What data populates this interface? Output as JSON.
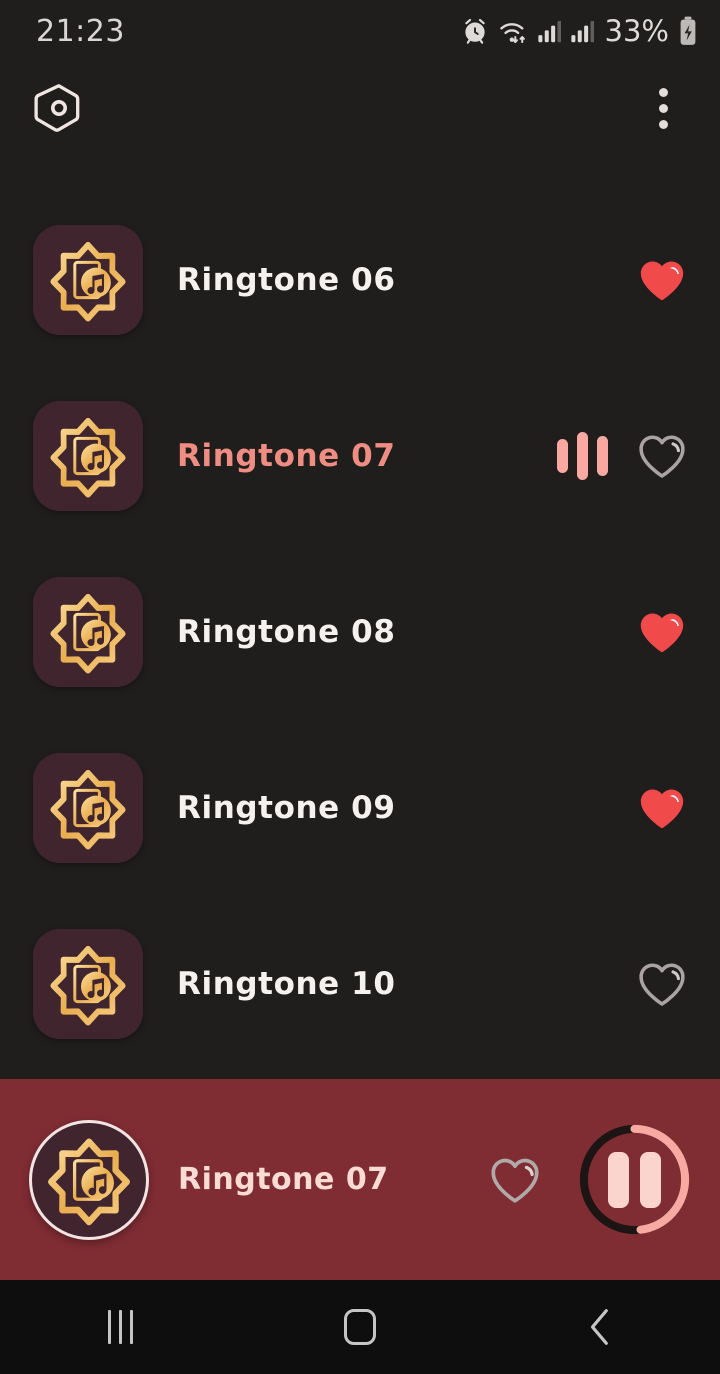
{
  "status_bar": {
    "time": "21:23",
    "battery_percent": "33%",
    "icons": [
      "alarm-icon",
      "wifi-icon",
      "signal-icon-1",
      "signal-icon-2",
      "battery-charging-icon"
    ]
  },
  "app_bar": {
    "logo_icon": "hexagon-logo-icon",
    "overflow_icon": "more-vertical-icon"
  },
  "list": {
    "items": [
      {
        "title": "Ringtone 06",
        "favorite": true,
        "playing": false
      },
      {
        "title": "Ringtone 07",
        "favorite": false,
        "playing": true
      },
      {
        "title": "Ringtone 08",
        "favorite": true,
        "playing": false
      },
      {
        "title": "Ringtone 09",
        "favorite": true,
        "playing": false
      },
      {
        "title": "Ringtone 10",
        "favorite": false,
        "playing": false
      }
    ],
    "thumb_icon": "ringtone-star-music-icon",
    "equalizer_icon": "equalizer-bars-icon",
    "favorite_icon_filled": "heart-filled-icon",
    "favorite_icon_outline": "heart-outline-icon"
  },
  "player": {
    "title": "Ringtone 07",
    "art_icon": "ringtone-star-music-icon",
    "favorite": false,
    "favorite_icon": "heart-outline-icon",
    "transport_icon": "pause-icon",
    "progress_percent": 48
  },
  "nav_bar": {
    "recents_icon": "recents-icon",
    "home_icon": "home-icon",
    "back_icon": "back-chevron-icon"
  },
  "colors": {
    "background": "#201e1d",
    "player_background": "#7f2c33",
    "accent_pink": "#ef8d83",
    "heart_red": "#f04a4a",
    "gold": "#f0c068",
    "thumb_background": "#40252f",
    "text_primary": "#f4f1ef",
    "player_text": "#fbdcd4"
  }
}
